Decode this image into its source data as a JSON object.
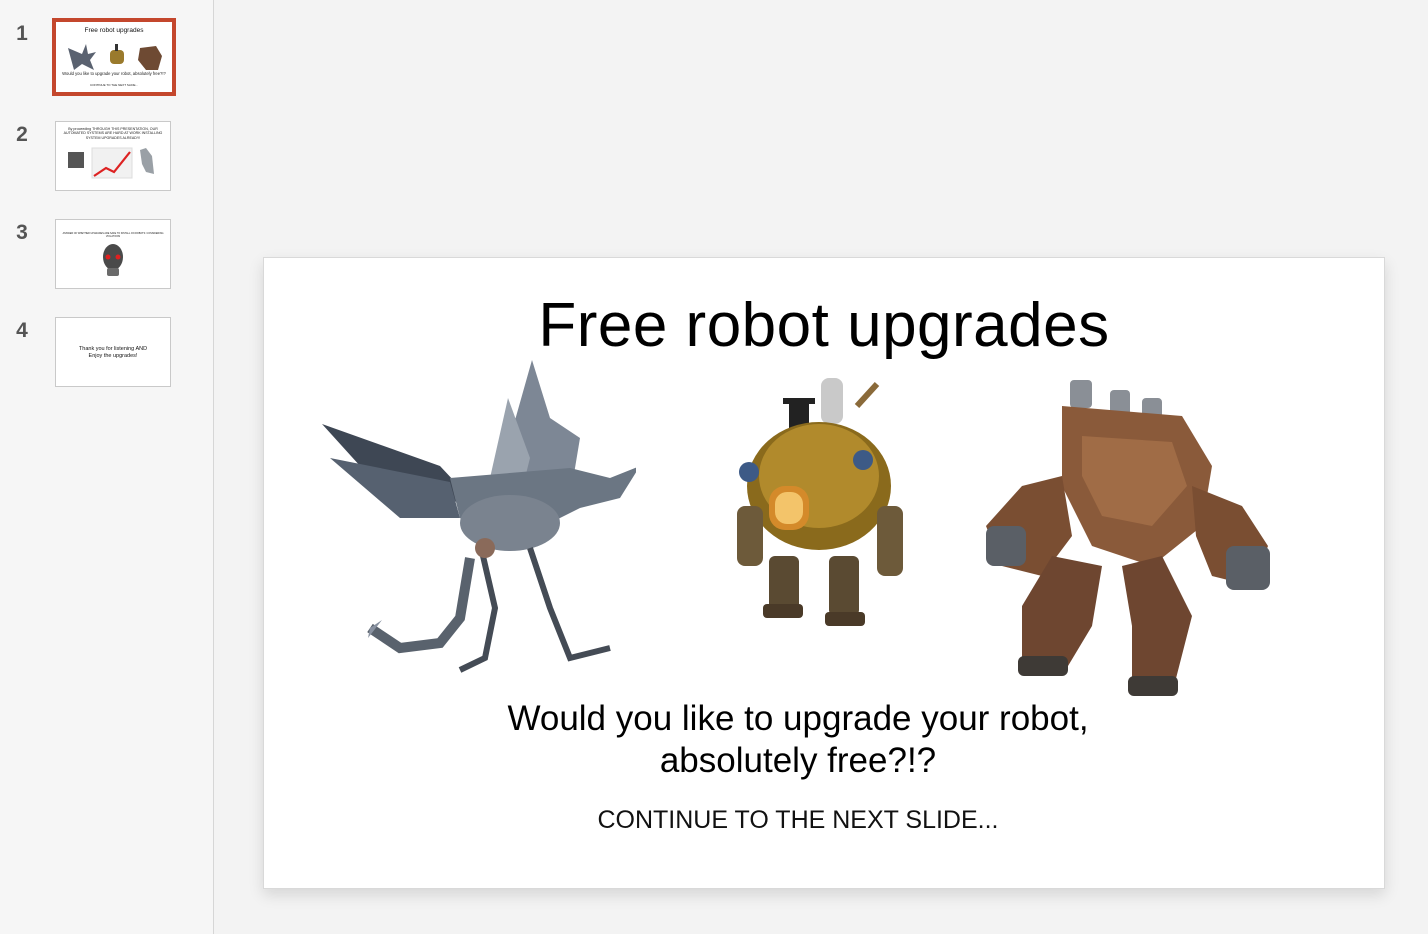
{
  "sidebar": {
    "slides": [
      {
        "number": "1",
        "title": "Free robot upgrades",
        "subtitle": "Would you like to upgrade your robot, absolutely free?!?",
        "note": "CONTINUE TO THE NEXT SLIDE..."
      },
      {
        "number": "2",
        "text": "By proceeding THROUGH THIS PRESENTATION, OUR AUTOMATED SYSTEMS ARE HARD AT WORK INSTALLING SYSTEM UPGRADES ALREADY!"
      },
      {
        "number": "3",
        "text": "ANSWER OF WHETHER UPGRADES ARE SAFE TO INSTALL ON ROBOTS: CONSIDERING VIOLATIONS"
      },
      {
        "number": "4",
        "text": "Thank you for listening AND Enjoy the upgrades!"
      }
    ]
  },
  "slide": {
    "title": "Free robot upgrades",
    "subtitle": "Would you like to upgrade your robot, absolutely free?!?",
    "note": "CONTINUE TO THE NEXT SLIDE..."
  },
  "colors": {
    "selection_border": "#c4472d",
    "sidebar_bg": "#f6f6f6",
    "canvas_bg": "#f3f3f3"
  },
  "icons": {
    "robot_1": "mechanical-dragon-image",
    "robot_2": "steampunk-robot-image",
    "robot_3": "wooden-mech-robot-image"
  }
}
